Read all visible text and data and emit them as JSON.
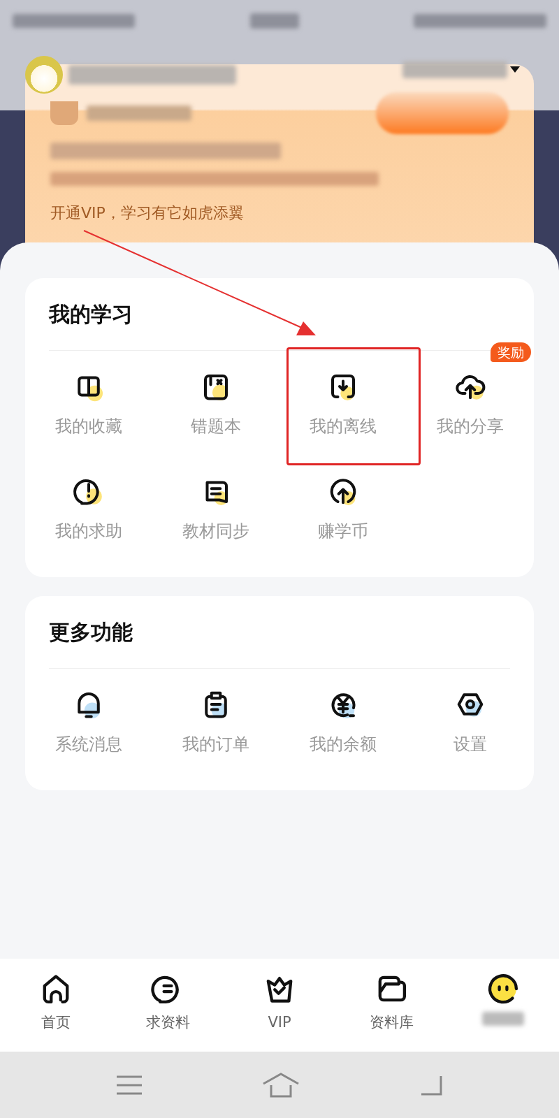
{
  "promo": {
    "text": "开通VIP，学习有它如虎添翼"
  },
  "sections": [
    {
      "title": "我的学习",
      "items": [
        {
          "label": "我的收藏",
          "kind": "book",
          "highlighted": false
        },
        {
          "label": "错题本",
          "kind": "notebook",
          "highlighted": false
        },
        {
          "label": "我的离线",
          "kind": "download",
          "highlighted": true
        },
        {
          "label": "我的分享",
          "kind": "cloud",
          "highlighted": false,
          "badge": "奖励"
        },
        {
          "label": "我的求助",
          "kind": "alert",
          "highlighted": false
        },
        {
          "label": "教材同步",
          "kind": "textbook",
          "highlighted": false
        },
        {
          "label": "赚学币",
          "kind": "coin",
          "highlighted": false
        }
      ]
    },
    {
      "title": "更多功能",
      "items": [
        {
          "label": "系统消息",
          "kind": "bell",
          "highlighted": false
        },
        {
          "label": "我的订单",
          "kind": "clipboard",
          "highlighted": false
        },
        {
          "label": "我的余额",
          "kind": "yen",
          "highlighted": false
        },
        {
          "label": "设置",
          "kind": "settings",
          "highlighted": false
        }
      ]
    }
  ],
  "tabs": [
    {
      "label": "首页",
      "kind": "home"
    },
    {
      "label": "求资料",
      "kind": "chat"
    },
    {
      "label": "VIP",
      "kind": "crown"
    },
    {
      "label": "资料库",
      "kind": "folder"
    },
    {
      "kind": "face"
    }
  ]
}
